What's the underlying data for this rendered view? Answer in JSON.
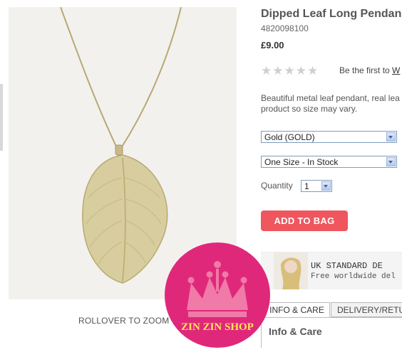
{
  "product": {
    "title": "Dipped Leaf Long Pendan",
    "code": "4820098100",
    "price": "£9.00",
    "rating_stars": 0,
    "review_prompt_prefix": "Be the first to",
    "review_prompt_link": "W",
    "description_line1": "Beautiful metal leaf pendant, real lea",
    "description_line2": "product so size may vary."
  },
  "options": {
    "colour_value": "Gold (GOLD)",
    "size_value": "One Size - In Stock",
    "quantity_label": "Quantity",
    "quantity_value": "1"
  },
  "actions": {
    "add_to_bag": "ADD TO BAG",
    "rollover_zoom": "ROLLOVER TO ZOOM"
  },
  "banner": {
    "line1": "UK STANDARD DE",
    "line2": "Free worldwide del"
  },
  "tabs": [
    {
      "label": "INFO & CARE"
    },
    {
      "label": "DELIVERY/RETU"
    }
  ],
  "info_heading": "Info & Care",
  "watermark": {
    "text": "ZIN ZIN SHOP"
  },
  "colors": {
    "add_to_bag_bg": "#f0565d",
    "logo_circle": "#e0287a",
    "crown": "#f07aa8",
    "logo_text": "#ffe45c"
  }
}
